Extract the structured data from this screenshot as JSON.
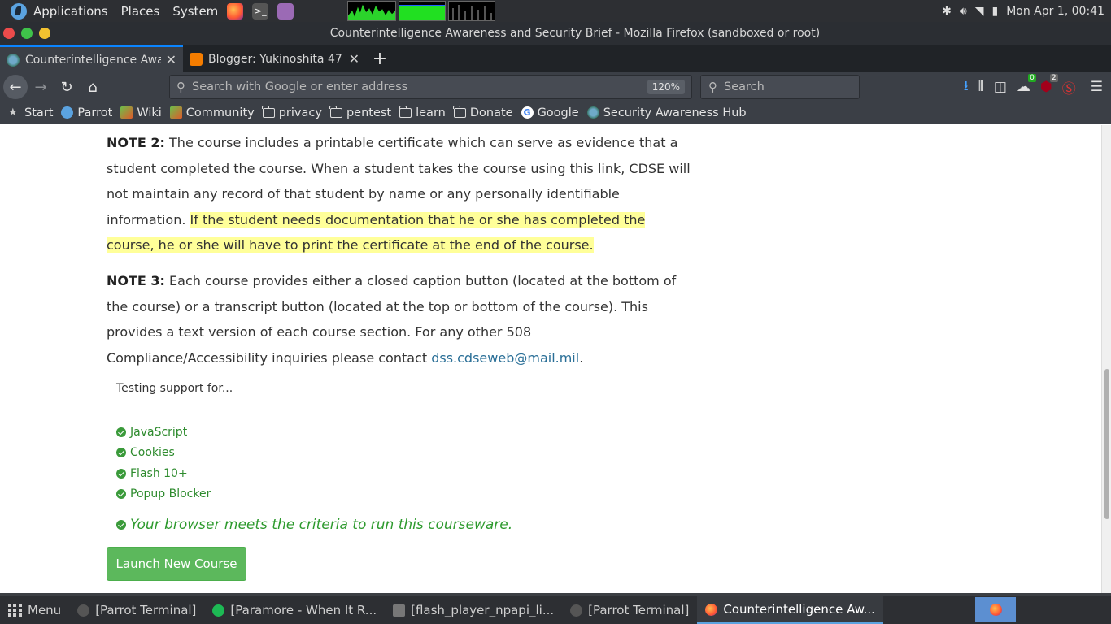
{
  "top_panel": {
    "menus": [
      "Applications",
      "Places",
      "System"
    ],
    "clock": "Mon Apr 1, 00:41"
  },
  "window": {
    "title": "Counterintelligence Awareness and Security Brief - Mozilla Firefox (sandboxed or root)"
  },
  "tabs": [
    {
      "label": "Counterintelligence Awa",
      "active": true
    },
    {
      "label": "Blogger: Yukinoshita 47",
      "active": false
    }
  ],
  "urlbar": {
    "placeholder": "Search with Google or enter address",
    "zoom": "120%"
  },
  "searchbar": {
    "placeholder": "Search"
  },
  "toolbar_badges": {
    "ghostery": "0",
    "ublock": "2"
  },
  "bookmarks": [
    {
      "label": "Start",
      "icon": "star-icon"
    },
    {
      "label": "Parrot",
      "icon": "parrot-icon"
    },
    {
      "label": "Wiki",
      "icon": "wiki-icon"
    },
    {
      "label": "Community",
      "icon": "community-icon"
    },
    {
      "label": "privacy",
      "icon": "folder-icon"
    },
    {
      "label": "pentest",
      "icon": "folder-icon"
    },
    {
      "label": "learn",
      "icon": "folder-icon"
    },
    {
      "label": "Donate",
      "icon": "folder-icon"
    },
    {
      "label": "Google",
      "icon": "google-icon"
    },
    {
      "label": "Security Awareness Hub",
      "icon": "globe-icon"
    }
  ],
  "page": {
    "note2_label": "NOTE 2:",
    "note2_text": "The course includes a printable certificate which can serve as evidence that a student completed the course. When a student takes the course using this link, CDSE will not maintain any record of that student by name or any personally identifiable information.",
    "note2_highlight": "If the student needs documentation that he or she has completed the course, he or she will have to print the certificate at the end of the course.",
    "note3_label": "NOTE 3:",
    "note3_text": "Each course provides either a closed caption button (located at the bottom of the course) or a transcript button (located at the top or bottom of the course). This provides a text version of each course section. For any other 508 Compliance/Accessibility inquiries please contact",
    "note3_email": "dss.cdseweb@mail.mil",
    "note3_end": ".",
    "testing_label": "Testing support for...",
    "checks": [
      "JavaScript",
      "Cookies",
      "Flash 10+",
      "Popup Blocker"
    ],
    "criteria": "Your browser meets the criteria to run this courseware.",
    "launch_button": "Launch New Course"
  },
  "taskbar": {
    "menu_label": "Menu",
    "tasks": [
      "[Parrot Terminal]",
      "[Paramore - When It R...",
      "[flash_player_npapi_li...",
      "[Parrot Terminal]",
      "Counterintelligence Aw..."
    ]
  },
  "colors": {
    "accent": "#0a84ff",
    "highlight": "#ffff99",
    "success_green": "#5cb85c",
    "link": "#2a6f97"
  }
}
